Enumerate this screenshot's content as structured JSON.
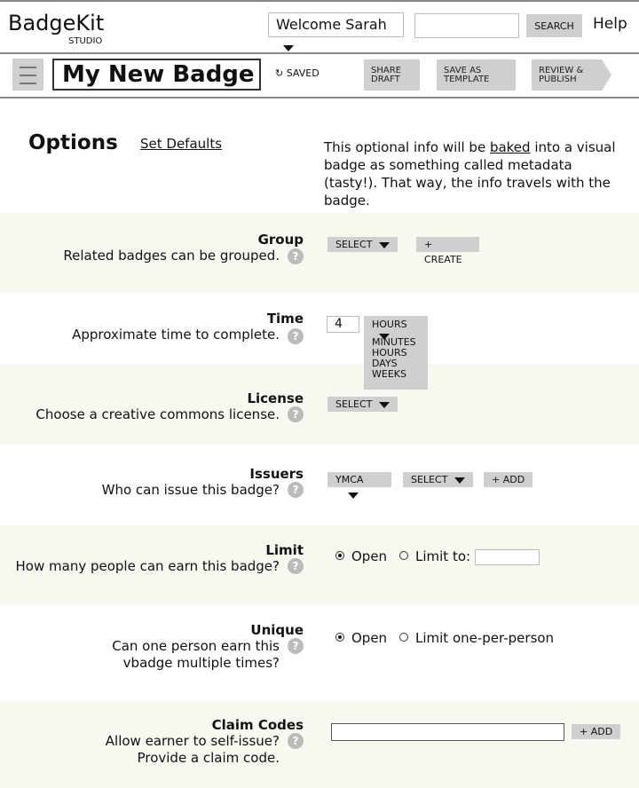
{
  "header": {
    "brand": "BadgeKit",
    "sub": "STUDIO",
    "user_menu": "Welcome Sarah",
    "search_value": "",
    "search_button": "SEARCH",
    "help": "Help"
  },
  "toolbar": {
    "title": "My New Badge",
    "saved": "SAVED",
    "share": [
      "SHARE",
      "DRAFT"
    ],
    "template": [
      "SAVE AS",
      "TEMPLATE"
    ],
    "publish": [
      "REVIEW &",
      "PUBLISH"
    ]
  },
  "options": {
    "title": "Options",
    "set_defaults": "Set Defaults",
    "intro_pre": "This optional info will be ",
    "intro_link": "baked",
    "intro_post": " into a visual badge as something called metadata (tasty!). That way, the info travels with the badge."
  },
  "group": {
    "label": "Group",
    "desc": "Related badges can be grouped.",
    "select": "SELECT",
    "create": "+ CREATE"
  },
  "time": {
    "label": "Time",
    "desc": "Approximate time to complete.",
    "value": "4",
    "unit": "HOURS",
    "options": [
      "MINUTES",
      "HOURS",
      "DAYS",
      "WEEKS"
    ]
  },
  "license": {
    "label": "License",
    "desc": "Choose a creative commons license.",
    "select": "SELECT"
  },
  "issuers": {
    "label": "Issuers",
    "desc": "Who can issue this badge?",
    "issuer": "YMCA",
    "select": "SELECT",
    "add": "+ ADD"
  },
  "limit": {
    "label": "Limit",
    "desc": "How many people can earn this badge?",
    "open": "Open",
    "limit_to": "Limit to:",
    "limit_value": ""
  },
  "unique": {
    "label": "Unique",
    "desc1": "Can one person earn this",
    "desc2": "vbadge multiple times?",
    "open": "Open",
    "one": "Limit one-per-person"
  },
  "claim": {
    "label": "Claim Codes",
    "desc1": "Allow earner to self-issue?",
    "desc2": "Provide a claim code.",
    "value": "",
    "add": "+ ADD"
  },
  "help_glyph": "?"
}
